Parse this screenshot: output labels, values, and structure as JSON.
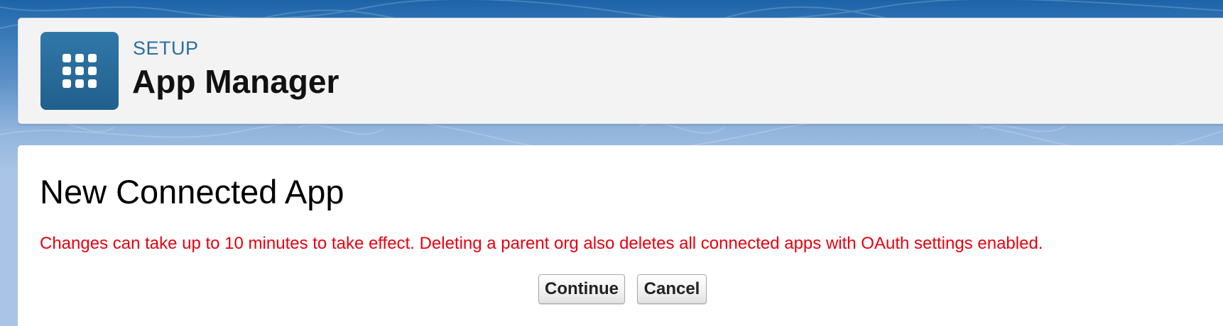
{
  "header": {
    "breadcrumb": "SETUP",
    "title": "App Manager",
    "tile_icon": "app-launcher-grid-icon"
  },
  "main": {
    "title": "New Connected App",
    "warning": "Changes can take up to 10 minutes to take effect. Deleting a parent org also deletes all connected apps with OAuth settings enabled.",
    "buttons": {
      "continue_label": "Continue",
      "cancel_label": "Cancel"
    }
  },
  "colors": {
    "tile": "#2a6fa0",
    "setup_label": "#2a6fa0",
    "warning": "#e8000e"
  }
}
